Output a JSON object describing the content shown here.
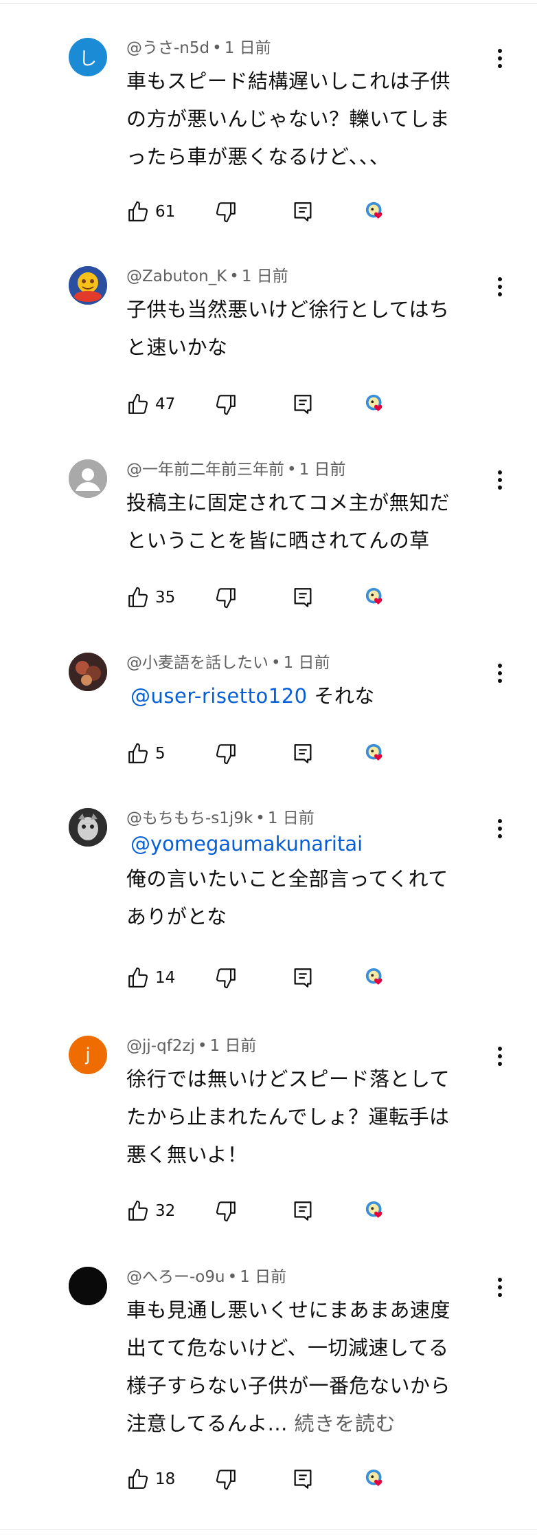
{
  "comments": [
    {
      "handle": "@うさ-n5d",
      "time": "1 日前",
      "avatar_letter": "し",
      "avatar_color": "#1b8bd6",
      "avatar_icon": "letter-avatar",
      "lines": [
        "車もスピード結構遅いしこれは子供",
        "の方が悪いんじゃない？轢いてしま",
        "ったら車が悪くなるけど､､､"
      ],
      "likes": "61"
    },
    {
      "handle": "@Zabuton_K",
      "time": "1 日前",
      "avatar_icon": "cartoon-avatar",
      "lines": [
        "子供も当然悪いけど徐行としてはち",
        "と速いかな"
      ],
      "likes": "47"
    },
    {
      "handle": "@一年前二年前三年前",
      "time": "1 日前",
      "avatar_icon": "default-person-avatar",
      "lines": [
        "投稿主に固定されてコメ主が無知だ",
        "ということを皆に晒されてんの草"
      ],
      "likes": "35"
    },
    {
      "handle": "@小麦語を話したい",
      "time": "1 日前",
      "avatar_icon": "photo-avatar",
      "mention": "@user-risetto120",
      "mention_suffix": " それな",
      "lines": [],
      "likes": "5"
    },
    {
      "handle": "@もちもち-s1j9k",
      "time": "1 日前",
      "avatar_icon": "photo-avatar",
      "mention": "@yomegaumakunaritai",
      "lines": [
        "俺の言いたいこと全部言ってくれて",
        "ありがとな"
      ],
      "likes": "14"
    },
    {
      "handle": "@jj-qf2zj",
      "time": "1 日前",
      "avatar_letter": "j",
      "avatar_color": "#ef6c00",
      "avatar_icon": "letter-avatar",
      "lines": [
        "徐行では無いけどスピード落として",
        "たから止まれたんでしょ？運転手は",
        "悪く無いよ！"
      ],
      "likes": "32"
    },
    {
      "handle": "@へろー-o9u",
      "time": "1 日前",
      "avatar_color": "#0f0f0f",
      "avatar_icon": "dark-avatar",
      "lines": [
        "車も見通し悪いくせにまあまあ速度",
        "出てて危ないけど、一切減速してる",
        "様子すらない子供が一番危ないから",
        "注意してるんよ..."
      ],
      "read_more": "続きを読む",
      "likes": "18"
    }
  ],
  "icons": {
    "like": "thumb-up-icon",
    "dislike": "thumb-down-icon",
    "reply": "reply-comment-icon",
    "creator_heart": "creator-heart-icon",
    "menu": "more-vert-icon"
  },
  "colors": {
    "mention": "#065fd4",
    "heart": "#e8003d",
    "meta": "#606060"
  }
}
